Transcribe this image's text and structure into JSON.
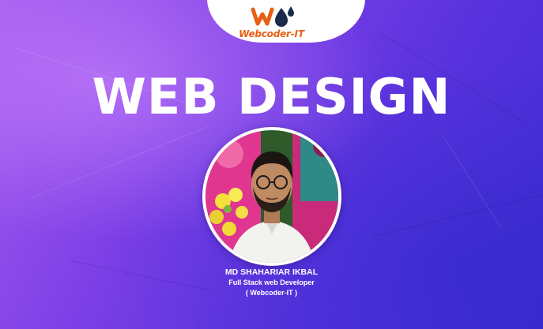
{
  "brand": {
    "name": "Webcoder-IT",
    "logo_icon": "webcoder-w-with-drops-icon",
    "colors": {
      "orange": "#e85f13",
      "navy": "#1b2a4a"
    }
  },
  "headline": "WEB DESIGN",
  "profile": {
    "photo": "portrait-photo",
    "name": "MD SHAHARIAR IKBAL",
    "role": "Full Stack web Developer",
    "company": "( Webcoder-IT )"
  },
  "background": {
    "accent_light": "#a45cf0",
    "accent_dark": "#3e2bd0"
  }
}
